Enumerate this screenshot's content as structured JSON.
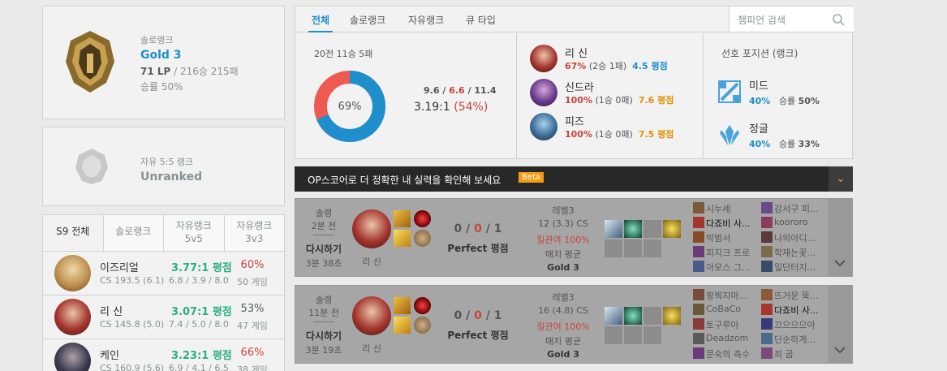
{
  "solo": {
    "rank_type": "솔로랭크",
    "tier": "Gold 3",
    "lp": "71 LP",
    "record": " / 216승 215패",
    "winrate": "승률 50%"
  },
  "flex": {
    "rank_type": "자유 5:5 랭크",
    "tier": "Unranked"
  },
  "champ_tabs": [
    {
      "l1": "S9 전체",
      "l2": ""
    },
    {
      "l1": "솔로랭크",
      "l2": ""
    },
    {
      "l1": "자유랭크",
      "l2": "5v5"
    },
    {
      "l1": "자유랭크",
      "l2": "3v3"
    }
  ],
  "champions": [
    {
      "name": "이즈리얼",
      "cs": "CS 193.5 (6.1)",
      "kda": "3.77:1 평점",
      "kda_detail": "6.8 / 3.9 / 8.0",
      "winrate": "60%",
      "games": "50 게임",
      "wr_color": "#c6443e",
      "color": "#d9b36a"
    },
    {
      "name": "리 신",
      "cs": "CS 145.8 (5.0)",
      "kda": "3.07:1 평점",
      "kda_detail": "7.4 / 5.0 / 8.0",
      "winrate": "53%",
      "games": "47 게임",
      "wr_color": "#555e5e",
      "color": "#a6352f"
    },
    {
      "name": "케인",
      "cs": "CS 160.9 (5.6)",
      "kda": "3.23:1 평점",
      "kda_detail": "6.9 / 4.1 / 6.5",
      "winrate": "66%",
      "games": "38 게임",
      "wr_color": "#c6443e",
      "color": "#3b3b4f"
    }
  ],
  "summary_tabs": [
    "전체",
    "솔로랭크",
    "자유랭크",
    "큐 타입"
  ],
  "search": {
    "placeholder": "챔피언 검색"
  },
  "summary": {
    "record": "20전 11승 5패",
    "winrate_pct": "69%",
    "win_fraction": 0.69,
    "kda_k": "9.6",
    "kda_d": "6.6",
    "kda_a": "11.4",
    "kda_ratio": "3.19:1",
    "kill_part": "(54%)",
    "colors": {
      "win": "#1f8ecd",
      "loss": "#ee5a52"
    }
  },
  "recent_champs": [
    {
      "name": "리 신",
      "pct": "67%",
      "rec": "(2승 1패)",
      "kda": "4.5 평점",
      "kda_color": "#1f8ecd",
      "color": "#a6352f"
    },
    {
      "name": "신드라",
      "pct": "100%",
      "rec": "(1승 0패)",
      "kda": "7.6 평점",
      "kda_color": "#e19205",
      "color": "#6b3c8f"
    },
    {
      "name": "피즈",
      "pct": "100%",
      "rec": "(1승 0패)",
      "kda": "7.5 평점",
      "kda_color": "#e19205",
      "color": "#3c6e9a"
    }
  ],
  "positions": {
    "title": "선호 포지션 (랭크)",
    "items": [
      {
        "name": "미드",
        "pct": "40%",
        "wr_label": "승률",
        "wr": "50%",
        "icon": "mid-lane-icon"
      },
      {
        "name": "정글",
        "pct": "40%",
        "wr_label": "승률",
        "wr": "33%",
        "icon": "jungle-icon"
      }
    ]
  },
  "banner": {
    "text": "OP스코어로 더 정확한 내 실력을 확인해 보세요",
    "beta": "Beta",
    "toggle": "⌄"
  },
  "games": [
    {
      "type": "솔랭",
      "ago": "2분 전",
      "result": "다시하기",
      "length": "3분 38초",
      "champ": "리 신",
      "k": "0",
      "d": "0",
      "a": "1",
      "perf": "Perfect 평점",
      "level": "레벨3",
      "cs": "12 (3.3) CS",
      "kp": "킬관여 100%",
      "match": "매치 평균",
      "tier": "Gold 3",
      "team1": [
        "시누세",
        "다죠비 사...",
        "박범서",
        "피지크 프로",
        "아모스 그..."
      ],
      "team2": [
        "강서구 피...",
        "koororo",
        "나의아디...",
        "학재는꽃...",
        "일단터지..."
      ]
    },
    {
      "type": "솔랭",
      "ago": "11분 전",
      "result": "다시하기",
      "length": "3분 19초",
      "champ": "리 신",
      "k": "0",
      "d": "0",
      "a": "1",
      "perf": "Perfect 평점",
      "level": "레벨3",
      "cs": "16 (4.8) CS",
      "kp": "킬관여 100%",
      "match": "매치 평균",
      "tier": "Gold 3",
      "team1": [
        "팡찍지마...",
        "CoBaCo",
        "토구루아",
        "Deadzom",
        "문숙의 측수"
      ],
      "team2": [
        "뜨거운 뚝...",
        "다죠비 사...",
        "끄으으으아",
        "단순하게...",
        "죄 곰"
      ]
    }
  ]
}
